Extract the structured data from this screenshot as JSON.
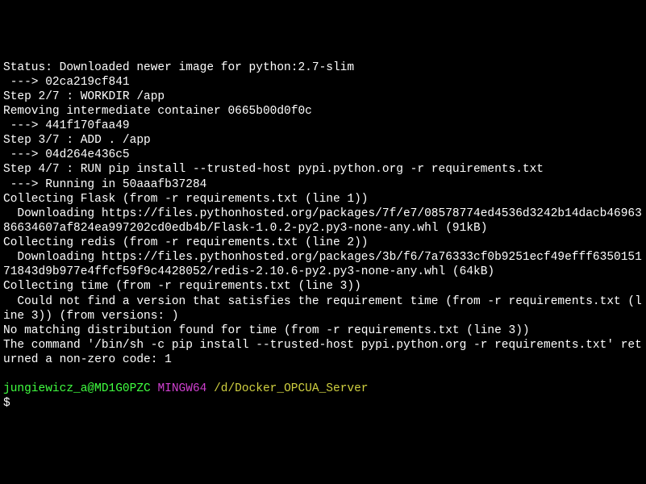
{
  "output": {
    "lines": [
      "Status: Downloaded newer image for python:2.7-slim",
      " ---> 02ca219cf841",
      "Step 2/7 : WORKDIR /app",
      "Removing intermediate container 0665b00d0f0c",
      " ---> 441f170faa49",
      "Step 3/7 : ADD . /app",
      " ---> 04d264e436c5",
      "Step 4/7 : RUN pip install --trusted-host pypi.python.org -r requirements.txt",
      " ---> Running in 50aaafb37284",
      "Collecting Flask (from -r requirements.txt (line 1))",
      "  Downloading https://files.pythonhosted.org/packages/7f/e7/08578774ed4536d3242b14dacb4696386634607af824ea997202cd0edb4b/Flask-1.0.2-py2.py3-none-any.whl (91kB)",
      "Collecting redis (from -r requirements.txt (line 2))",
      "  Downloading https://files.pythonhosted.org/packages/3b/f6/7a76333cf0b9251ecf49efff635015171843d9b977e4ffcf59f9c4428052/redis-2.10.6-py2.py3-none-any.whl (64kB)",
      "Collecting time (from -r requirements.txt (line 3))",
      "  Could not find a version that satisfies the requirement time (from -r requirements.txt (line 3)) (from versions: )",
      "No matching distribution found for time (from -r requirements.txt (line 3))",
      "The command '/bin/sh -c pip install --trusted-host pypi.python.org -r requirements.txt' returned a non-zero code: 1"
    ]
  },
  "prompt": {
    "user": "jungiewicz_a@MD1G0PZC",
    "env": "MINGW64",
    "path": "/d/Docker_OPCUA_Server",
    "symbol": "$"
  }
}
